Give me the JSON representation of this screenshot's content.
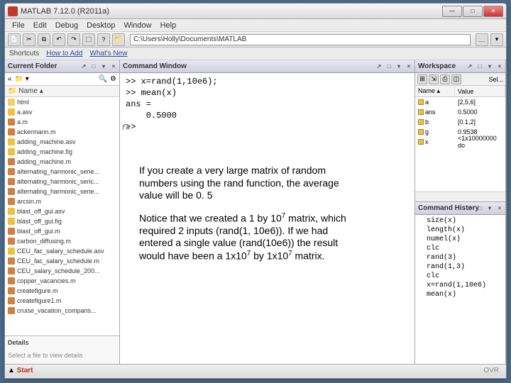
{
  "title": "MATLAB 7.12.0 (R2011a)",
  "menu": [
    "File",
    "Edit",
    "Debug",
    "Desktop",
    "Window",
    "Help"
  ],
  "path": "C:\\Users\\Holly\\Documents\\MATLAB",
  "shortcuts": {
    "label": "Shortcuts",
    "howto": "How to Add",
    "whatsnew": "What's New"
  },
  "currentFolder": {
    "title": "Current Folder",
    "nameHeader": "Name ▴",
    "files": [
      {
        "n": "html",
        "t": "folder"
      },
      {
        "n": "a.asv",
        "t": "f"
      },
      {
        "n": "a.m",
        "t": "m"
      },
      {
        "n": "ackermann.m",
        "t": "m"
      },
      {
        "n": "adding_machine.asv",
        "t": "f"
      },
      {
        "n": "adding_machine.fig",
        "t": "f"
      },
      {
        "n": "adding_machine.m",
        "t": "m"
      },
      {
        "n": "alternating_harmonic_serie...",
        "t": "m"
      },
      {
        "n": "alternating_harmonic_seric...",
        "t": "m"
      },
      {
        "n": "alternating_harmonic_serie...",
        "t": "m"
      },
      {
        "n": "arcsin.m",
        "t": "m"
      },
      {
        "n": "blast_off_gui.asv",
        "t": "f"
      },
      {
        "n": "blast_off_gui.fig",
        "t": "f"
      },
      {
        "n": "blast_off_gui.m",
        "t": "m"
      },
      {
        "n": "carbon_diffusing.m",
        "t": "m"
      },
      {
        "n": "CEU_fac_salary_schedule.asv",
        "t": "f"
      },
      {
        "n": "CEU_fac_salary_schedule.m",
        "t": "m"
      },
      {
        "n": "CEU_salary_schedule_200...",
        "t": "m"
      },
      {
        "n": "copper_vacancies.m",
        "t": "m"
      },
      {
        "n": "createfigure.m",
        "t": "m"
      },
      {
        "n": "createfigure1.m",
        "t": "m"
      },
      {
        "n": "cruise_vacation_comparis...",
        "t": "m"
      }
    ],
    "details": "Details",
    "detailsHint": "Select a file to view details"
  },
  "commandWindow": {
    "title": "Command Window",
    "lines": [
      ">> x=rand(1,10e6);",
      ">> mean(x)",
      "ans =",
      "    0.5000",
      ">> "
    ],
    "fx": "fx"
  },
  "overlay": {
    "p1_a": "If you create a very large matrix of random numbers using the rand function, the average value will be 0. 5",
    "p2_a": "Notice that we created a 1 by 10",
    "p2_b": " matrix, which required 2 inputs (rand(1, 10e6)).  If we had entered a single value (rand(10e6)) the result would have been a 1x10",
    "p2_c": "  by  1x10",
    "p2_d": " matrix.",
    "sup": "7"
  },
  "workspace": {
    "title": "Workspace",
    "sel": "Sel...",
    "cols": {
      "name": "Name ▴",
      "value": "Value"
    },
    "rows": [
      {
        "n": "a",
        "v": "[2,5,6]"
      },
      {
        "n": "ans",
        "v": "0.5000"
      },
      {
        "n": "b",
        "v": "[0.1,2]"
      },
      {
        "n": "g",
        "v": "0.9538"
      },
      {
        "n": "x",
        "v": "<1x10000000 do"
      }
    ]
  },
  "history": {
    "title": "Command History",
    "items": [
      "size(x)",
      "length(x)",
      "numel(x)",
      "clc",
      "rand(3)",
      "rand(1,3)",
      "clc",
      "x=rand(1,10e6)",
      "mean(x)"
    ]
  },
  "status": {
    "start": "Start",
    "ovr": "OVR"
  }
}
